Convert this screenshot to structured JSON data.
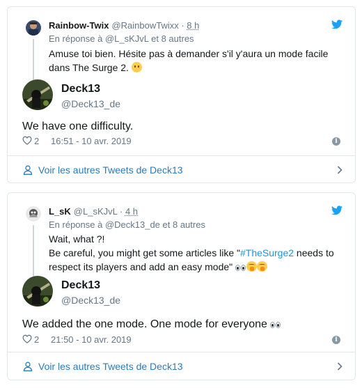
{
  "tweets": [
    {
      "parent": {
        "name": "Rainbow-Twix",
        "handle": "@RainbowTwixx",
        "dot": " · ",
        "time": "8 h",
        "reply_to": "En réponse à @L_sKJvL et 8 autres",
        "text_line1": "Amuse toi bien. Hésite pas à demander s'il y'aura un mode facile",
        "text_line2": "dans The Surge 2. "
      },
      "main": {
        "name": "Deck13",
        "handle": "@Deck13_de",
        "text": "We have one difficulty.",
        "likes": "2",
        "timestamp": "16:51 - 10 avr. 2019"
      },
      "footer_label": "Voir les autres Tweets de Deck13"
    },
    {
      "parent": {
        "name": "L_sK",
        "handle": "@L_sKJvL",
        "dot": " · ",
        "time": "4 h",
        "reply_to": "En réponse à @Deck13_de et 8 autres",
        "text_line1": "Wait, what ?!",
        "text_line2_pre": "Be careful, you might get some articles like \"",
        "hashtag": "#TheSurge2",
        "text_line2_post": " needs to",
        "text_line3": "respect its players and add an easy mode\" "
      },
      "main": {
        "name": "Deck13",
        "handle": "@Deck13_de",
        "text": "We added the one mode. One mode for everyone ",
        "likes": "2",
        "timestamp": "21:50 - 10 avr. 2019"
      },
      "footer_label": "Voir les autres Tweets de Deck13"
    }
  ],
  "icons": {
    "brand": "twitter-bird-icon",
    "like": "heart-icon",
    "info": "info-icon",
    "user": "user-icon",
    "chevron": "chevron-right-icon"
  },
  "colors": {
    "twitter_blue": "#1da1f2",
    "link_blue": "#2b7bb9",
    "hashtag_blue": "#1b95e0",
    "muted_gray": "#657786",
    "border": "#e1e8ed"
  }
}
